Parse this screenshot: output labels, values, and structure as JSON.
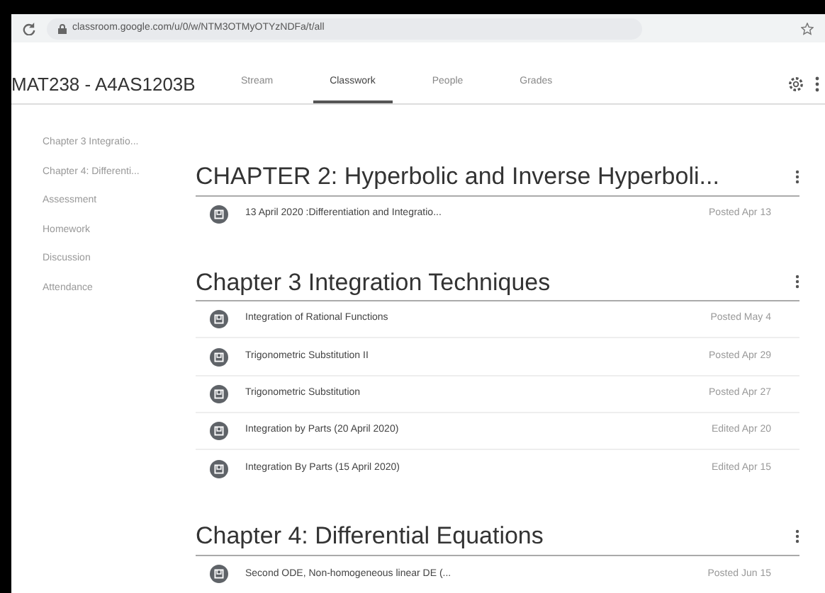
{
  "browser": {
    "url": "classroom.google.com/u/0/w/NTM3OTMyOTYzNDFa/t/all"
  },
  "header": {
    "class_name": "MAT238 - A4AS1203B",
    "tabs": [
      {
        "label": "Stream",
        "selected": false
      },
      {
        "label": "Classwork",
        "selected": true
      },
      {
        "label": "People",
        "selected": false
      },
      {
        "label": "Grades",
        "selected": false
      }
    ]
  },
  "sidebar": {
    "items": [
      "Chapter 3 Integratio...",
      "Chapter 4: Differenti...",
      "Assessment",
      "Homework",
      "Discussion",
      "Attendance"
    ]
  },
  "topics": [
    {
      "title": "CHAPTER 2: Hyperbolic and Inverse Hyperboli...",
      "materials": [
        {
          "title": "13 April 2020 :Differentiation and Integratio...",
          "date": "Posted Apr 13"
        }
      ]
    },
    {
      "title": "Chapter 3 Integration Techniques",
      "materials": [
        {
          "title": "Integration of Rational Functions",
          "date": "Posted May 4"
        },
        {
          "title": "Trigonometric Substitution II",
          "date": "Posted Apr 29"
        },
        {
          "title": "Trigonometric Substitution",
          "date": "Posted Apr 27"
        },
        {
          "title": "Integration by Parts (20 April 2020)",
          "date": "Edited Apr 20"
        },
        {
          "title": "Integration By Parts (15 April 2020)",
          "date": "Edited Apr 15"
        }
      ]
    },
    {
      "title": "Chapter 4: Differential Equations",
      "materials": [
        {
          "title": "Second ODE, Non-homogeneous linear DE (...",
          "date": "Posted Jun 15"
        }
      ]
    }
  ]
}
